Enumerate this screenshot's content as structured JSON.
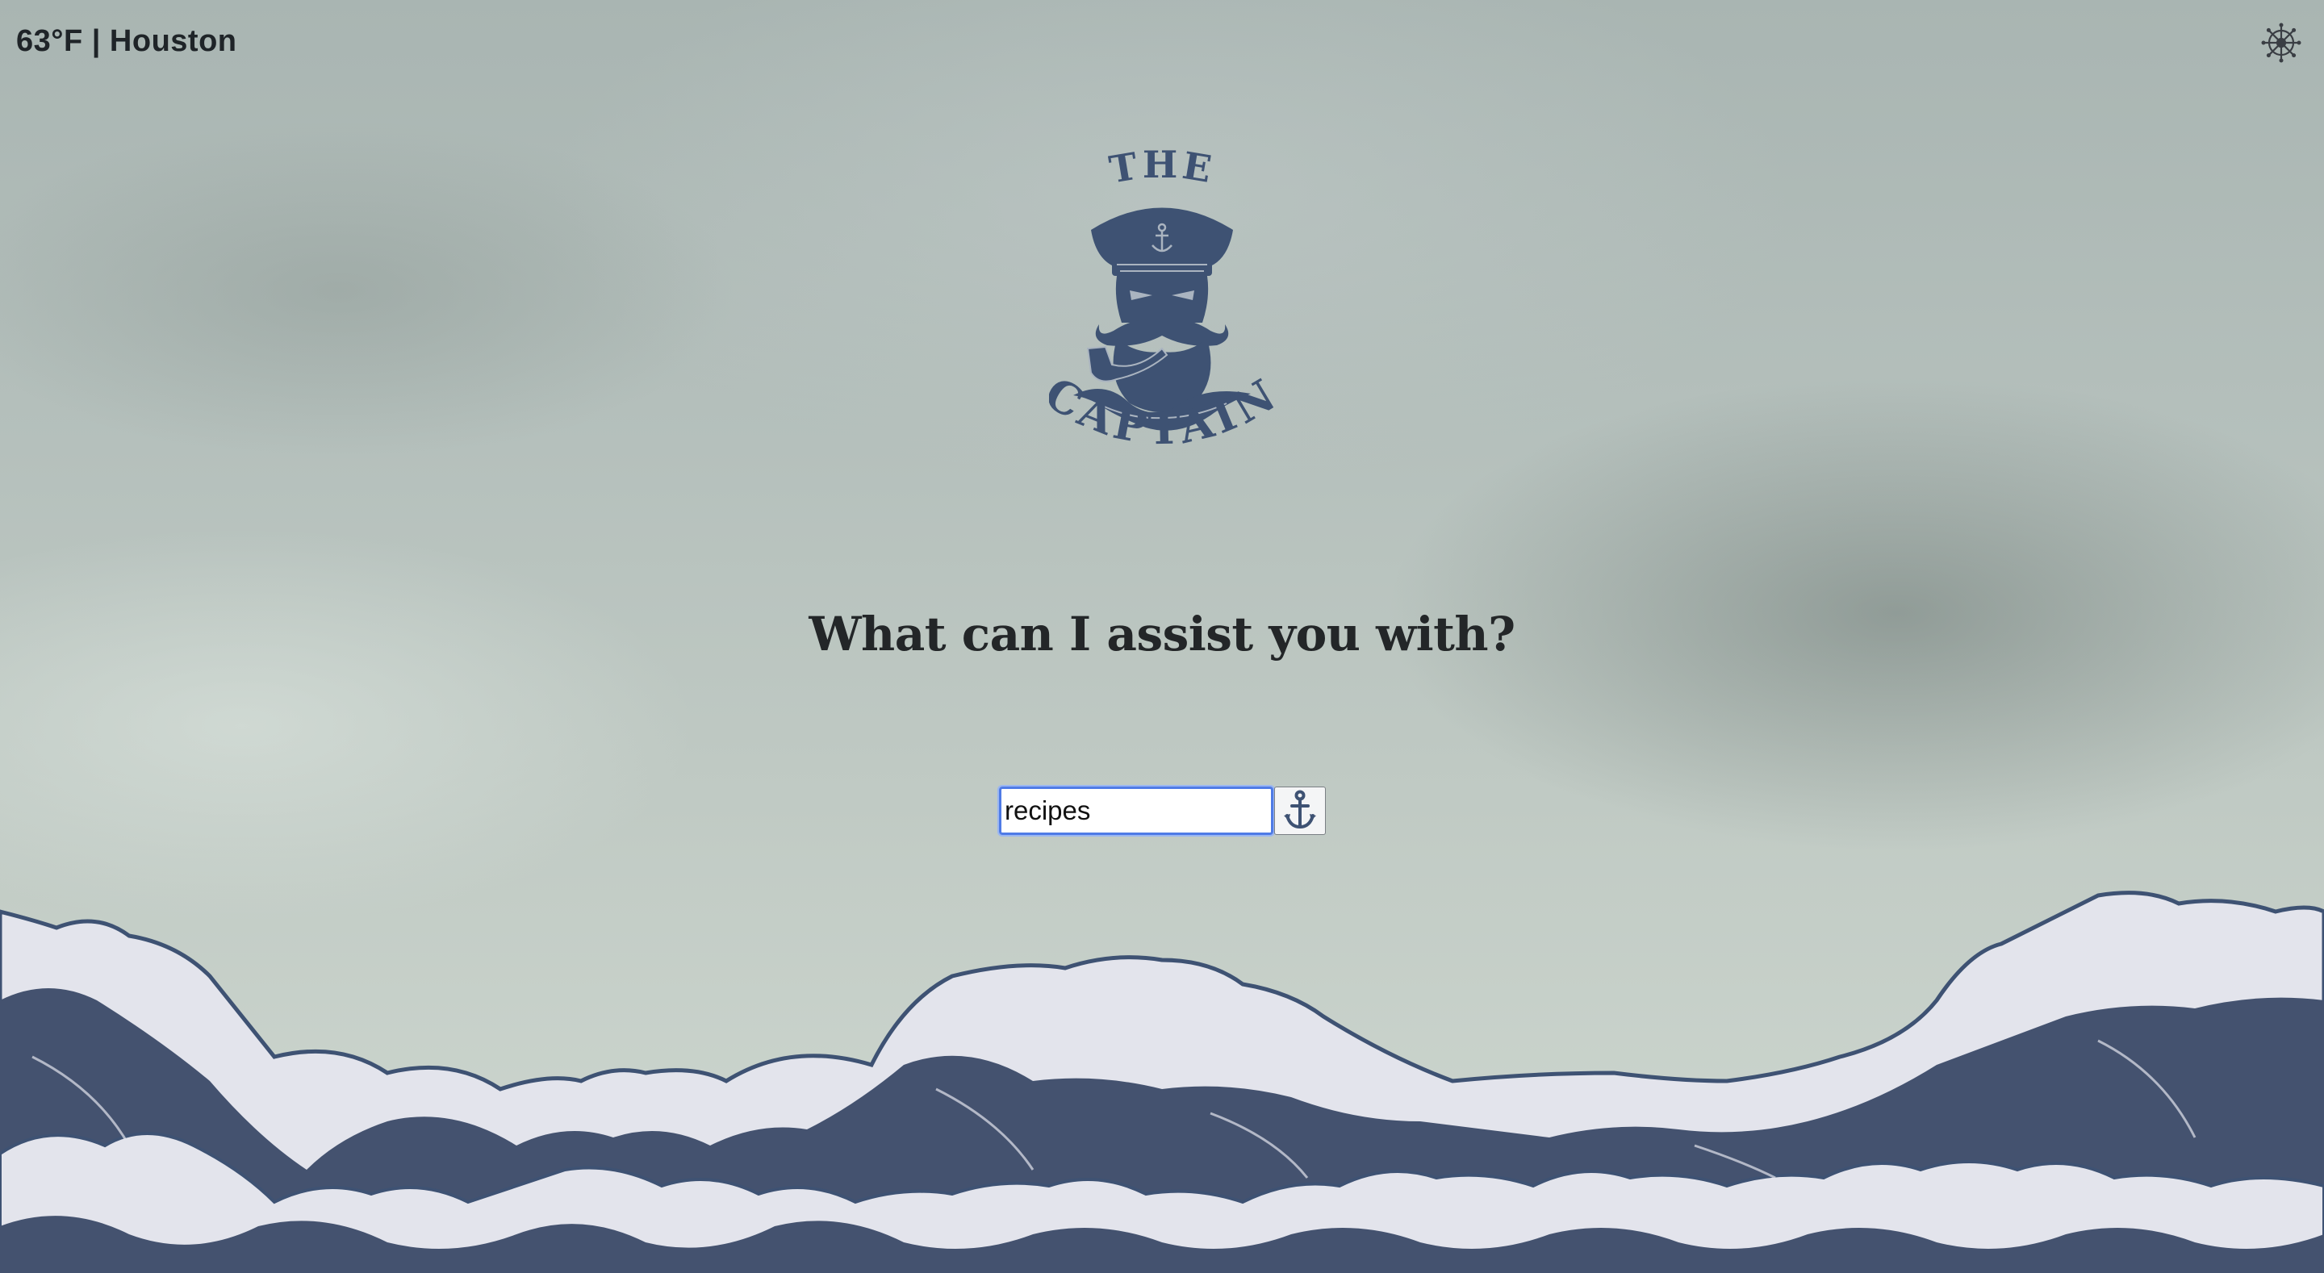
{
  "weather": {
    "text": "63°F | Houston"
  },
  "logo": {
    "top_text": "THE",
    "bottom_text": "CAPTAIN",
    "icon": "captain-logo-icon"
  },
  "headline": "What can I assist you with?",
  "search": {
    "value": "recipes",
    "button_icon": "anchor-icon"
  },
  "settings": {
    "icon": "ship-wheel-icon"
  },
  "colors": {
    "navy": "#3e5273",
    "wave_light": "#e3e4ec",
    "text_dark": "#232628",
    "focus_blue": "#4f7be6"
  }
}
